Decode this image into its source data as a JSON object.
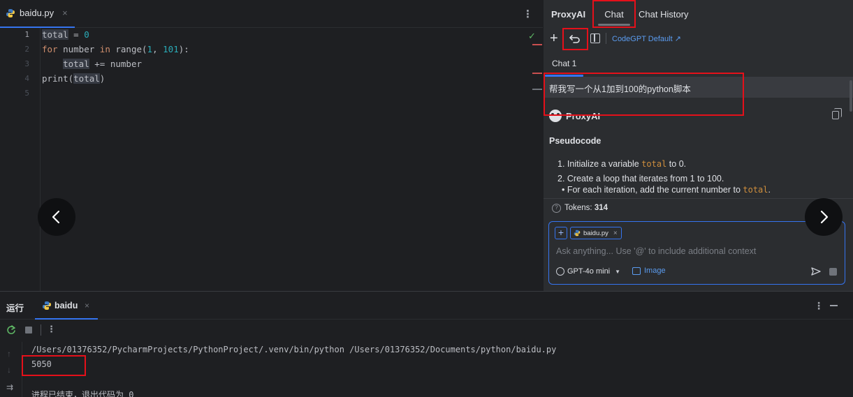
{
  "editor": {
    "file_tab": "baidu.py",
    "close_glyph": "×",
    "more_glyph": "⋮",
    "line_numbers": [
      "1",
      "2",
      "3",
      "4",
      "5"
    ],
    "code": {
      "l1_var": "total",
      "l1_rest": " = ",
      "l1_num": "0",
      "l2_kw1": "for",
      "l2_a": " number ",
      "l2_kw2": "in",
      "l2_b": " range(",
      "l2_n1": "1",
      "l2_c": ", ",
      "l2_n2": "101",
      "l2_d": "):",
      "l3_indent": "    ",
      "l3_var": "total",
      "l3_rest": " += number",
      "l4_a": "print(",
      "l4_var": "total",
      "l4_b": ")"
    },
    "check_glyph": "✓"
  },
  "panel": {
    "title": "ProxyAI",
    "tabs": [
      "Chat",
      "Chat History"
    ],
    "model_link": "CodeGPT Default ↗",
    "chat_tab": "Chat 1",
    "user_message": "帮我写一个从1加到100的python脚本",
    "reply": {
      "author": "ProxyAI",
      "heading": "Pseudocode",
      "step1_pre": "1. Initialize a variable ",
      "step1_code": "total",
      "step1_post": " to 0.",
      "step2": "2. Create a loop that iterates from 1 to 100.",
      "step3_pre": "• For each iteration, add the current number to ",
      "step3_code": "total",
      "step3_post": "."
    },
    "tokens_label": "Tokens: ",
    "tokens_value": "314",
    "input": {
      "file_chip": "baidu.py",
      "placeholder": "Ask anything... Use '@' to include additional context",
      "model": "GPT-4o mini",
      "image_label": "Image"
    }
  },
  "run": {
    "title": "运行",
    "tab": "baidu",
    "close_glyph": "×",
    "more_glyph": "⋮",
    "console": [
      "/Users/01376352/PycharmProjects/PythonProject/.venv/bin/python /Users/01376352/Documents/python/baidu.py",
      "5050",
      "进程已结束，退出代码为 0"
    ]
  },
  "colors": {
    "accent": "#3574f0",
    "highlight_box": "#e5101a",
    "keyword": "#cf8e6d",
    "number": "#2aacb8"
  }
}
